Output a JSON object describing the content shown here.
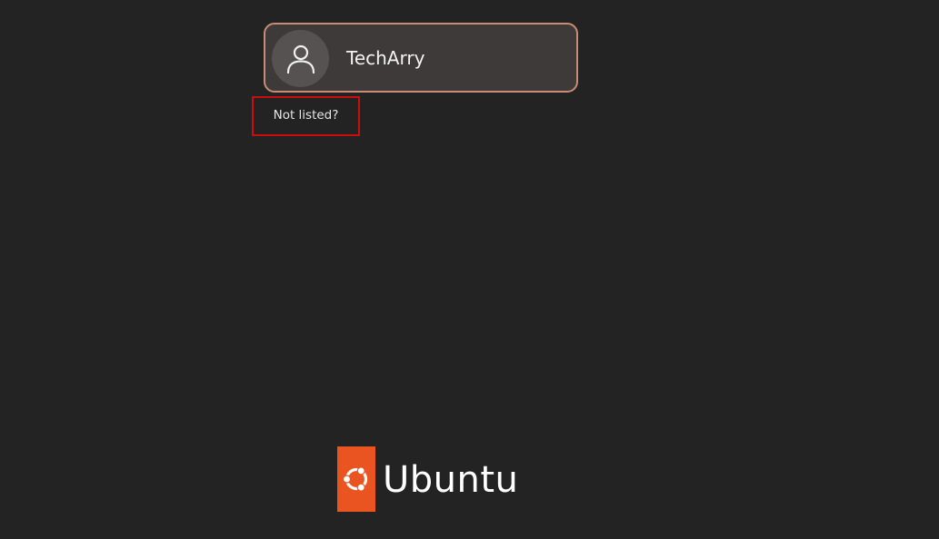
{
  "login": {
    "users": [
      {
        "name": "TechArry",
        "avatar_icon": "user-silhouette-icon"
      }
    ],
    "not_listed_label": "Not listed?"
  },
  "branding": {
    "logo_icon": "ubuntu-circle-of-friends-icon",
    "wordmark": "Ubuntu"
  },
  "colors": {
    "background": "#232323",
    "card_background": "#3d3a39",
    "card_border": "#c98c74",
    "avatar_background": "#555251",
    "highlight_border": "#c90e0e",
    "ubuntu_orange": "#e95420"
  }
}
